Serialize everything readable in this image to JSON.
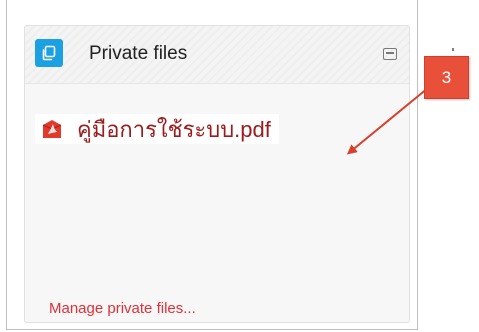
{
  "block": {
    "title": "Private files",
    "icon": "files-icon",
    "accent_color": "#1ba1e2"
  },
  "files": [
    {
      "name": "คู่มือการใช้ระบบ.pdf",
      "icon": "pdf-icon"
    }
  ],
  "manage_link": "Manage private files...",
  "annotation": {
    "number": "3",
    "color": "#e8503a"
  }
}
